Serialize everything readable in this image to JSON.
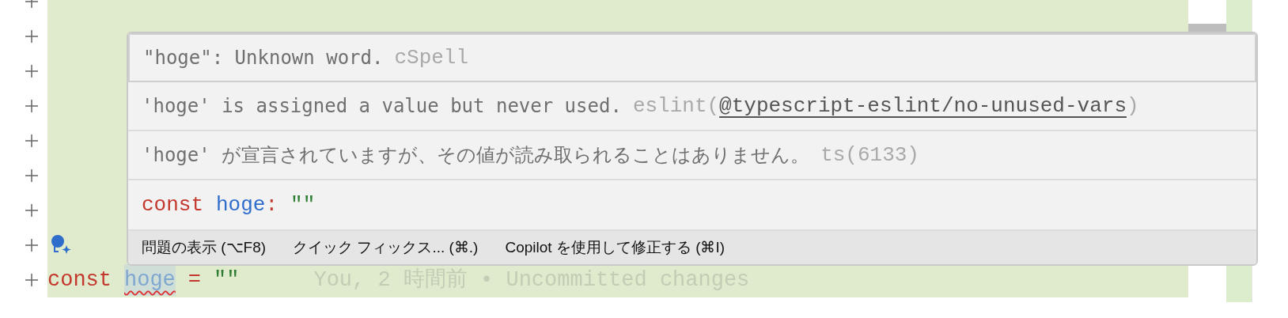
{
  "editor": {
    "lines": [
      {
        "kind": "added"
      },
      {
        "kind": "added"
      },
      {
        "kind": "added"
      },
      {
        "kind": "added"
      },
      {
        "kind": "added"
      },
      {
        "kind": "added"
      },
      {
        "kind": "added"
      },
      {
        "kind": "added",
        "lightbulb": true
      },
      {
        "kind": "added",
        "tokens": [
          {
            "kind": "keyword",
            "text": "const"
          },
          {
            "kind": "variable",
            "text": "hoge",
            "error": true
          },
          {
            "kind": "operator",
            "text": "="
          },
          {
            "kind": "string",
            "text": "\"\""
          }
        ],
        "blame": "You, 2 時間前 • Uncommitted changes"
      }
    ]
  },
  "hover": {
    "messages": [
      {
        "selected": true,
        "text": "\"hoge\": Unknown word.",
        "source": "cSpell"
      },
      {
        "selected": false,
        "text": "'hoge' is assigned a value but never used.",
        "source": "eslint(",
        "link": "@typescript-eslint/no-unused-vars",
        "source_end": ")"
      },
      {
        "selected": false,
        "text": "'hoge' が宣言されていますが、その値が読み取られることはありません。",
        "source": "ts(6133)"
      }
    ],
    "declaration": [
      {
        "kind": "keyword",
        "text": "const"
      },
      {
        "kind": "variable",
        "text": "hoge"
      },
      {
        "kind": "operator",
        "text": ":"
      },
      {
        "kind": "string",
        "text": "\"\""
      }
    ],
    "actions": [
      "問題の表示 (⌥F8)",
      "クイック フィックス... (⌘.)",
      "Copilot を使用して修正する (⌘I)"
    ]
  }
}
